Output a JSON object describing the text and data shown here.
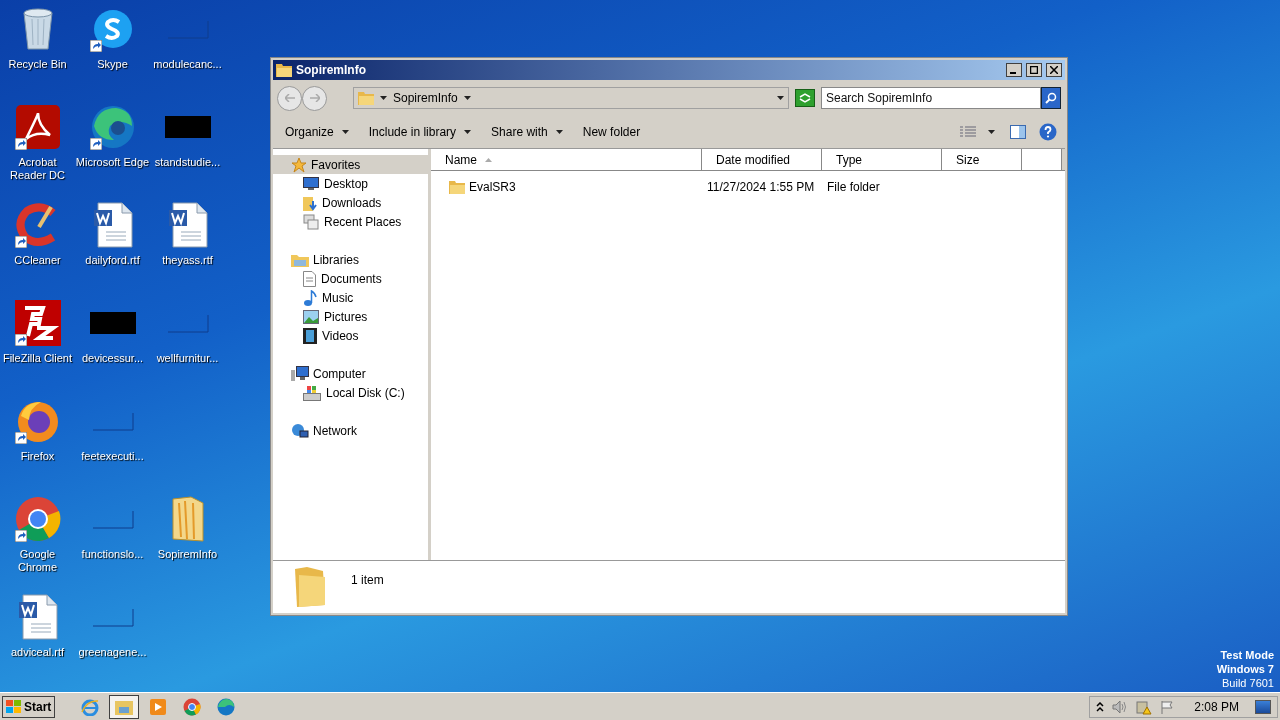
{
  "desktop_rows": [
    [
      {
        "label": "Recycle Bin",
        "kind": "recycle",
        "shortcut": false
      },
      {
        "label": "Skype",
        "kind": "skype",
        "shortcut": true
      },
      {
        "label": "modulecanc...",
        "kind": "blank",
        "shortcut": false
      }
    ],
    [
      {
        "label": "Acrobat Reader DC",
        "kind": "acrobat",
        "shortcut": true
      },
      {
        "label": "Microsoft Edge",
        "kind": "edge",
        "shortcut": true
      },
      {
        "label": "standstudie...",
        "kind": "black",
        "shortcut": false
      }
    ],
    [
      {
        "label": "CCleaner",
        "kind": "ccleaner",
        "shortcut": true
      },
      {
        "label": "dailyford.rtf",
        "kind": "word",
        "shortcut": false
      },
      {
        "label": "theyass.rtf",
        "kind": "word",
        "shortcut": false
      }
    ],
    [
      {
        "label": "FileZilla Client",
        "kind": "filezilla",
        "shortcut": true
      },
      {
        "label": "devicessur...",
        "kind": "black",
        "shortcut": false
      },
      {
        "label": "wellfurnitur...",
        "kind": "blank",
        "shortcut": false
      }
    ],
    [
      {
        "label": "Firefox",
        "kind": "firefox",
        "shortcut": true
      },
      {
        "label": "feetexecuti...",
        "kind": "blank",
        "shortcut": false
      }
    ],
    [
      {
        "label": "Google Chrome",
        "kind": "chrome",
        "shortcut": true
      },
      {
        "label": "functionslo...",
        "kind": "blank",
        "shortcut": false
      },
      {
        "label": "SopiremInfo",
        "kind": "folder",
        "shortcut": false
      }
    ],
    [
      {
        "label": "adviceal.rtf",
        "kind": "word",
        "shortcut": false
      },
      {
        "label": "greenagene...",
        "kind": "blank",
        "shortcut": false
      }
    ]
  ],
  "window": {
    "title": "SopiremInfo",
    "breadcrumb": "SopiremInfo",
    "search": {
      "placeholder": "Search SopiremInfo"
    },
    "toolbar": [
      {
        "label": "Organize",
        "dropdown": true
      },
      {
        "label": "Include in library",
        "dropdown": true
      },
      {
        "label": "Share with",
        "dropdown": true
      },
      {
        "label": "New folder",
        "dropdown": false
      }
    ],
    "nav_groups": [
      {
        "label": "Favorites",
        "kind": "favorites",
        "selected": true,
        "children": [
          {
            "label": "Desktop",
            "kind": "desktop"
          },
          {
            "label": "Downloads",
            "kind": "downloads"
          },
          {
            "label": "Recent Places",
            "kind": "recent"
          }
        ]
      },
      {
        "label": "Libraries",
        "kind": "libraries",
        "selected": false,
        "children": [
          {
            "label": "Documents",
            "kind": "documents"
          },
          {
            "label": "Music",
            "kind": "music"
          },
          {
            "label": "Pictures",
            "kind": "pictures"
          },
          {
            "label": "Videos",
            "kind": "videos"
          }
        ]
      },
      {
        "label": "Computer",
        "kind": "computer",
        "selected": false,
        "children": [
          {
            "label": "Local Disk (C:)",
            "kind": "disk"
          }
        ]
      },
      {
        "label": "Network",
        "kind": "network",
        "selected": false
      }
    ],
    "columns": [
      "Name",
      "Date modified",
      "Type",
      "Size"
    ],
    "rows": [
      {
        "name": "EvalSR3",
        "date": "11/27/2024 1:55 PM",
        "type": "File folder",
        "selected": false
      }
    ],
    "status": "1 item"
  },
  "desktop_notice": [
    "Test Mode",
    "Windows 7",
    "Build 7601"
  ],
  "taskbar": {
    "start": "Start",
    "apps": [
      {
        "kind": "ie",
        "selected": false
      },
      {
        "kind": "explorer",
        "selected": true
      },
      {
        "kind": "media",
        "selected": false
      },
      {
        "kind": "chrome",
        "selected": false
      },
      {
        "kind": "edge",
        "selected": false
      }
    ],
    "clock": "2:08 PM"
  }
}
